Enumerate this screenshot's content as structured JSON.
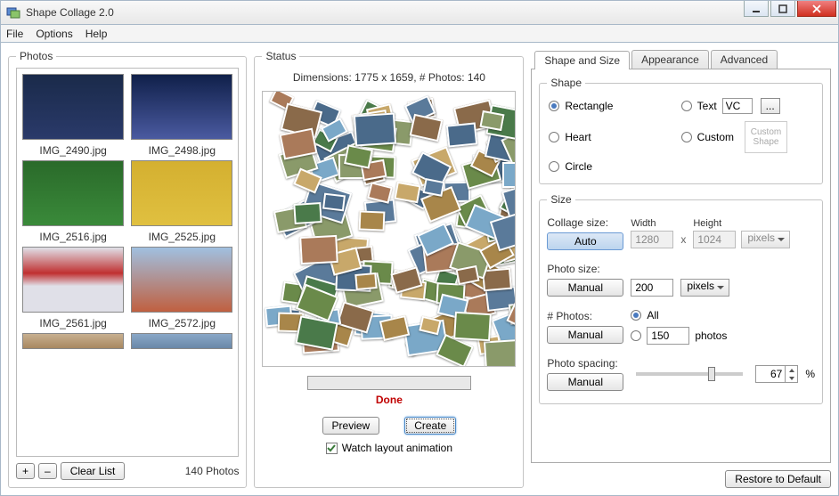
{
  "window": {
    "title": "Shape Collage 2.0"
  },
  "menu": {
    "file": "File",
    "options": "Options",
    "help": "Help"
  },
  "photos": {
    "legend": "Photos",
    "items": [
      {
        "label": "IMG_2490.jpg",
        "g": "linear-gradient(#1a2a4a,#2a3a6a)"
      },
      {
        "label": "IMG_2498.jpg",
        "g": "linear-gradient(#10204a,#4a5aa0)"
      },
      {
        "label": "IMG_2516.jpg",
        "g": "linear-gradient(#2a6a2a,#3a8a3a)"
      },
      {
        "label": "IMG_2525.jpg",
        "g": "linear-gradient(#d4b030,#e0c040)"
      },
      {
        "label": "IMG_2561.jpg",
        "g": "linear-gradient(#e0e0e8,#c03030 40%,#e0e0e8 60%)"
      },
      {
        "label": "IMG_2572.jpg",
        "g": "linear-gradient(#a0c0e0,#c06040)"
      }
    ],
    "add": "+",
    "remove": "–",
    "clear": "Clear List",
    "count": "140 Photos"
  },
  "status": {
    "legend": "Status",
    "dimensions": "Dimensions: 1775 x 1659, # Photos: 140",
    "done": "Done",
    "preview": "Preview",
    "create": "Create",
    "watch": "Watch layout animation"
  },
  "tabs": {
    "shape": "Shape and Size",
    "appearance": "Appearance",
    "advanced": "Advanced"
  },
  "shape": {
    "legend": "Shape",
    "rectangle": "Rectangle",
    "heart": "Heart",
    "circle": "Circle",
    "text": "Text",
    "text_val": "VC",
    "custom": "Custom",
    "browse": "...",
    "custom_shape": "Custom Shape"
  },
  "size": {
    "legend": "Size",
    "collage_size": "Collage size:",
    "auto": "Auto",
    "width_lbl": "Width",
    "height_lbl": "Height",
    "width": "1280",
    "height": "1024",
    "unit": "pixels",
    "photo_size": "Photo size:",
    "manual": "Manual",
    "photo_val": "200",
    "photo_unit": "pixels",
    "num_photos": "# Photos:",
    "all": "All",
    "count": "150",
    "photos_word": "photos",
    "spacing": "Photo spacing:",
    "spacing_val": "67",
    "pct": "%"
  },
  "restore": "Restore to Default"
}
